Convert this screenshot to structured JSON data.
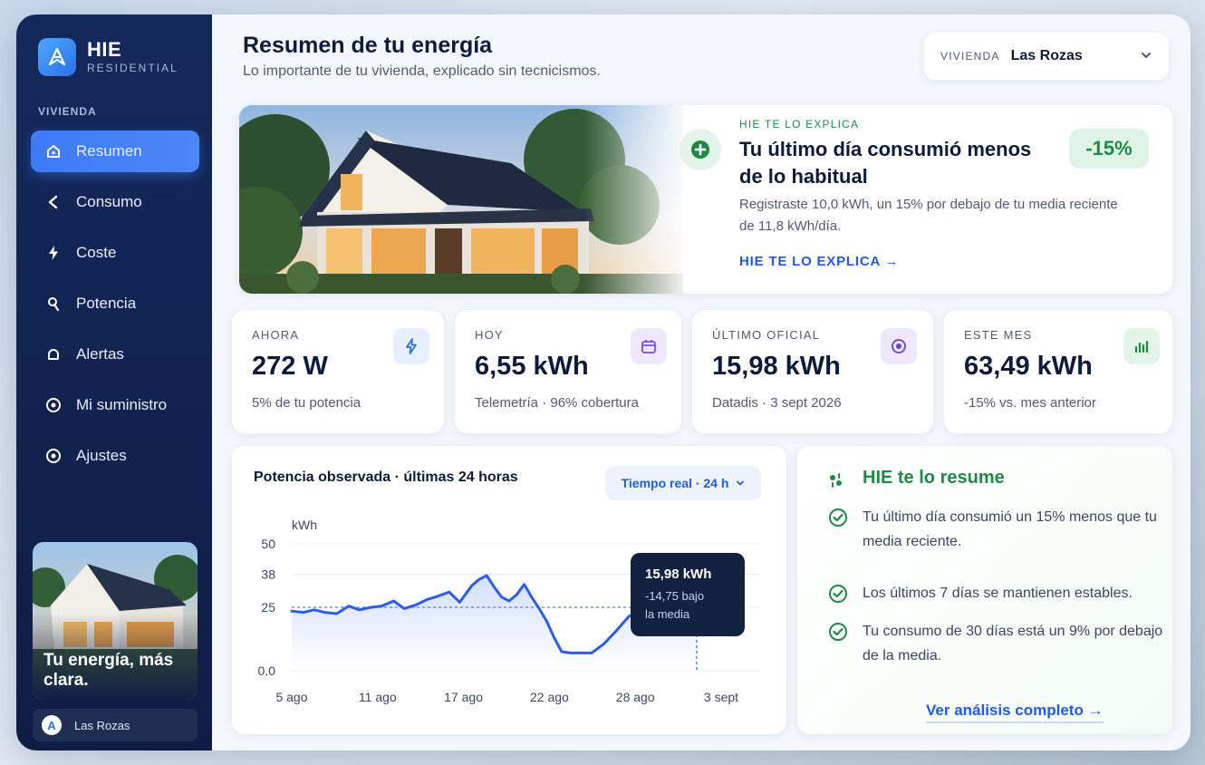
{
  "brand": {
    "name": "HIE",
    "sub": "RESIDENTIAL"
  },
  "sidebar": {
    "section": "VIVIENDA",
    "items": [
      {
        "label": "Resumen",
        "icon": "home-icon"
      },
      {
        "label": "Consumo",
        "icon": "consumption-icon"
      },
      {
        "label": "Coste",
        "icon": "bolt-icon"
      },
      {
        "label": "Potencia",
        "icon": "power-icon"
      },
      {
        "label": "Alertas",
        "icon": "bell-icon"
      },
      {
        "label": "Mi suministro",
        "icon": "supply-icon"
      },
      {
        "label": "Ajustes",
        "icon": "settings-icon"
      }
    ],
    "promo_text": "Tu energía, más clara.",
    "home_chip": {
      "initial": "A",
      "label": "Las Rozas"
    }
  },
  "header": {
    "title": "Resumen de tu energía",
    "subtitle": "Lo importante de tu vivienda, explicado sin tecnicismos.",
    "select_label": "VIVIENDA",
    "select_value": "Las Rozas"
  },
  "hero": {
    "kicker": "HIE TE LO EXPLICA",
    "title": "Tu último día consumió menos de lo habitual",
    "badge": "-15%",
    "description": "Registraste 10,0 kWh, un 15% por debajo de tu media reciente de 11,8 kWh/día.",
    "link": "HIE TE LO EXPLICA →"
  },
  "stats": [
    {
      "label": "AHORA",
      "value": "272 W",
      "note": "5% de tu potencia",
      "icon": "bolt-icon",
      "color": "#2a6fe8",
      "bg": "#e8f0fe"
    },
    {
      "label": "HOY",
      "value": "6,55 kWh",
      "note": "Telemetría · 96% cobertura",
      "icon": "calendar-icon",
      "color": "#7b4fe0",
      "bg": "#efe8fd"
    },
    {
      "label": "ÚLTIMO OFICIAL",
      "value": "15,98 kWh",
      "note": "Datadis · 3 sept 2026",
      "icon": "target-icon",
      "color": "#6a3fd8",
      "bg": "#efe8fd"
    },
    {
      "label": "ESTE MES",
      "value": "63,49 kWh",
      "note": "-15% vs. mes anterior",
      "icon": "bar-chart-icon",
      "color": "#1f8a46",
      "bg": "#e2f5e8"
    }
  ],
  "chart": {
    "title": "Potencia observada · últimas 24 horas",
    "pill": "Tiempo real · 24 h",
    "tooltip_value": "15,98 kWh",
    "tooltip_note_1": "-14,75 bajo",
    "tooltip_note_2": "la media"
  },
  "chart_data": {
    "type": "line",
    "ylabel": "kWh",
    "yticks": [
      "50",
      "38",
      "25",
      "0.0"
    ],
    "ytick_values": [
      50,
      38,
      25,
      0
    ],
    "ylim": [
      0,
      50
    ],
    "xticks": [
      "5 ago",
      "11 ago",
      "17 ago",
      "22 ago",
      "28 ago",
      "3 sept"
    ],
    "xlim": [
      0,
      29
    ],
    "grid": true,
    "reference_line": 25,
    "x": [
      0,
      0.8,
      1.5,
      2.2,
      3,
      3.8,
      4.5,
      5.3,
      6,
      6.8,
      7.5,
      8.3,
      9,
      9.8,
      10.5,
      11.2,
      12,
      12.5,
      13,
      13.5,
      14,
      14.5,
      15,
      15.5,
      16,
      16.5,
      17,
      17.5,
      18,
      18.6,
      19.2,
      20,
      20.8,
      21.6,
      22.5,
      23.4,
      24.2,
      25,
      25.8,
      26.5,
      27
    ],
    "y": [
      23.5,
      23,
      24,
      23,
      22.5,
      25.5,
      24,
      25,
      25.5,
      27.5,
      24.5,
      26,
      28,
      29.5,
      31,
      27,
      33.5,
      36,
      37.5,
      33,
      29,
      27.5,
      30,
      34,
      29,
      24.5,
      19.5,
      13,
      7.5,
      7,
      7,
      7,
      10.5,
      15.5,
      21.5,
      23.5,
      25,
      25,
      24.5,
      25,
      25
    ]
  },
  "summary": {
    "title": "HIE te lo resume",
    "items": [
      "Tu último día consumió un 15% menos que tu media reciente.",
      "Los últimos 7 días se mantienen estables.",
      "Tu consumo de 30 días está un 9% por debajo de la media."
    ],
    "link": "Ver análisis completo →"
  },
  "colors": {
    "accent": "#3d7bf5",
    "sidebar": "#14285a",
    "green": "#1f8a46",
    "line": "#2a5cf0"
  }
}
